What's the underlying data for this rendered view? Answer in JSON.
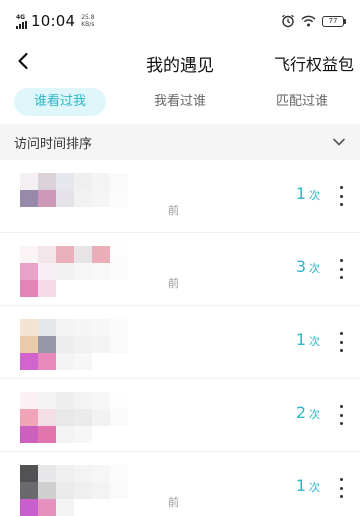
{
  "status_bar": {
    "network": "4G",
    "time": "10:04",
    "speed_value": "25.8",
    "speed_unit": "KB/s",
    "battery": "77"
  },
  "header": {
    "back_icon": "chevron-left-icon",
    "title": "我的遇见",
    "action": "飞行权益包"
  },
  "tabs": [
    {
      "label": "谁看过我",
      "active": true
    },
    {
      "label": "我看过谁",
      "active": false
    },
    {
      "label": "匹配过谁",
      "active": false
    }
  ],
  "sort": {
    "label": "访问时间排序",
    "icon": "chevron-down-icon"
  },
  "visitors": [
    {
      "suffix": "前",
      "count": "1",
      "unit": "次"
    },
    {
      "suffix": "前",
      "count": "3",
      "unit": "次"
    },
    {
      "suffix": "",
      "count": "1",
      "unit": "次"
    },
    {
      "suffix": "",
      "count": "2",
      "unit": "次"
    },
    {
      "suffix": "前",
      "count": "1",
      "unit": "次"
    }
  ],
  "colors": {
    "accent": "#2bb7c8",
    "tab_active_bg": "#dff7fa",
    "sort_bar_bg": "#f5f5f5"
  }
}
